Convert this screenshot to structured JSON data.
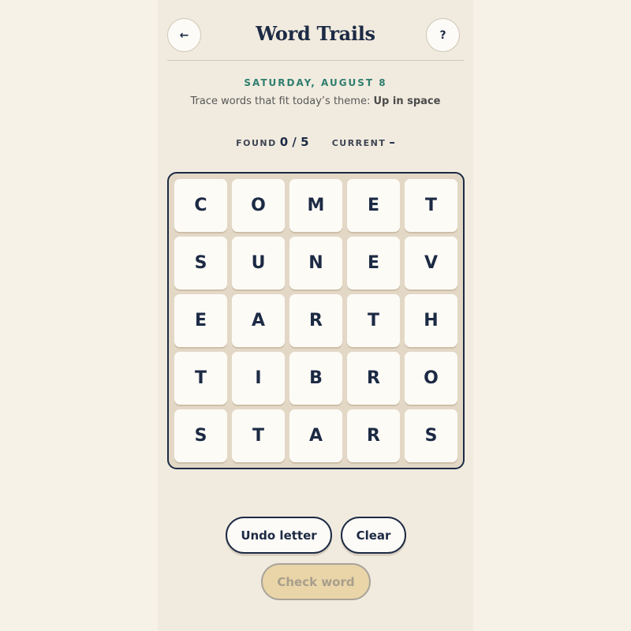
{
  "header": {
    "back_icon": "arrow-left-icon",
    "back_glyph": "←",
    "title": "Word Trails",
    "help_label": "?"
  },
  "puzzle": {
    "date": "SATURDAY, AUGUST 8",
    "theme_prefix": "Trace words that fit today’s theme:",
    "theme": "Up in space"
  },
  "stats": {
    "found_label": "FOUND",
    "found_value": "0 / 5",
    "current_label": "CURRENT",
    "current_value": "–"
  },
  "board": {
    "rows": [
      [
        "C",
        "O",
        "M",
        "E",
        "T"
      ],
      [
        "S",
        "U",
        "N",
        "E",
        "V"
      ],
      [
        "E",
        "A",
        "R",
        "T",
        "H"
      ],
      [
        "T",
        "I",
        "B",
        "R",
        "O"
      ],
      [
        "S",
        "T",
        "A",
        "R",
        "S"
      ]
    ]
  },
  "actions": {
    "undo_label": "Undo letter",
    "clear_label": "Clear",
    "check_label": "Check word"
  },
  "colors": {
    "ink": "#1c2a44",
    "accent_date": "#2f7e6e",
    "check_disabled": "#ead5a8"
  }
}
